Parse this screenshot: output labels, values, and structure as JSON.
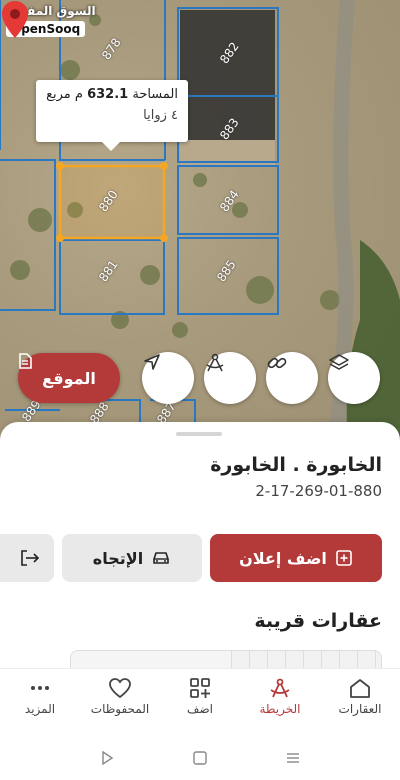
{
  "brand": {
    "arabic": "السوق المفتوح",
    "english": "OpenSooq"
  },
  "map": {
    "plot_labels": [
      "878",
      "882",
      "883",
      "880",
      "884",
      "881",
      "885",
      "889",
      "888",
      "887"
    ],
    "callout": {
      "area_label": "المساحة",
      "area_value": "632.1",
      "area_unit": "م مربع",
      "corners": "٤ زوايا"
    },
    "location_button": "الموقع",
    "buttons": [
      "layers-icon",
      "link-icon",
      "measure-icon",
      "navigate-icon"
    ]
  },
  "sheet": {
    "title": "الخابورة . الخابورة",
    "plot_id": "2-17-269-01-880",
    "add_ad_label": "اضف إعلان",
    "direction_label": "الإتجاه",
    "nearby_title": "عقارات قريبة"
  },
  "nav": {
    "items": [
      {
        "label": "العقارات",
        "icon": "home-icon"
      },
      {
        "label": "الخريطة",
        "icon": "map-compass-icon",
        "active": true
      },
      {
        "label": "اضف",
        "icon": "grid-add-icon"
      },
      {
        "label": "المحفوظات",
        "icon": "heart-icon"
      },
      {
        "label": "المزيد",
        "icon": "more-dots-icon"
      }
    ]
  },
  "colors": {
    "accent": "#b43a3a",
    "plot_border": "#2a78c2",
    "selected_plot": "#f5a623"
  }
}
